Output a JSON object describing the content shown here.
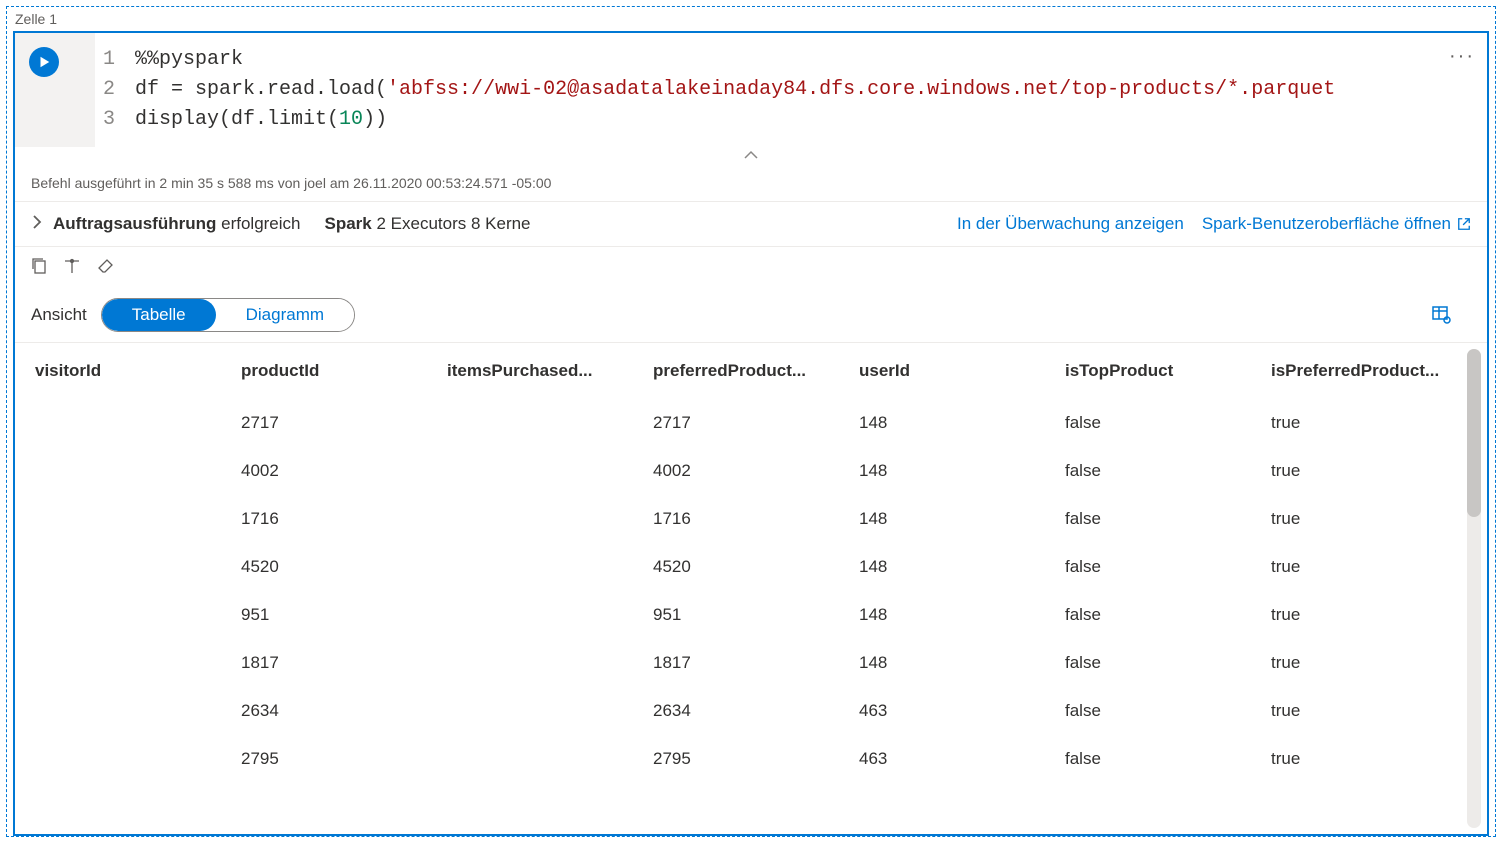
{
  "cell": {
    "label": "Zelle 1",
    "code": {
      "line1": "%%pyspark",
      "line2a": "df = spark.read.load(",
      "line2b": "'abfss://wwi-02@asadatalakeinaday84.dfs.core.windows.net/top-products/*.parquet",
      "line3a": "display(df.limit(",
      "line3b": "10",
      "line3c": "))"
    },
    "status": "Befehl ausgeführt in 2 min 35 s 588 ms von joel am 26.11.2020 00:53:24.571 -05:00",
    "execution": {
      "label": "Auftragsausführung",
      "state": "erfolgreich",
      "spark_label": "Spark",
      "spark_detail": "2 Executors 8 Kerne",
      "link_monitor": "In der Überwachung anzeigen",
      "link_sparkui": "Spark-Benutzeroberfläche öffnen"
    },
    "view": {
      "label": "Ansicht",
      "tab_table": "Tabelle",
      "tab_chart": "Diagramm"
    },
    "table": {
      "headers": [
        "visitorId",
        "productId",
        "itemsPurchased...",
        "preferredProduct...",
        "userId",
        "isTopProduct",
        "isPreferredProduct..."
      ],
      "rows": [
        [
          "",
          "2717",
          "",
          "2717",
          "148",
          "false",
          "true"
        ],
        [
          "",
          "4002",
          "",
          "4002",
          "148",
          "false",
          "true"
        ],
        [
          "",
          "1716",
          "",
          "1716",
          "148",
          "false",
          "true"
        ],
        [
          "",
          "4520",
          "",
          "4520",
          "148",
          "false",
          "true"
        ],
        [
          "",
          "951",
          "",
          "951",
          "148",
          "false",
          "true"
        ],
        [
          "",
          "1817",
          "",
          "1817",
          "148",
          "false",
          "true"
        ],
        [
          "",
          "2634",
          "",
          "2634",
          "463",
          "false",
          "true"
        ],
        [
          "",
          "2795",
          "",
          "2795",
          "463",
          "false",
          "true"
        ]
      ]
    }
  }
}
